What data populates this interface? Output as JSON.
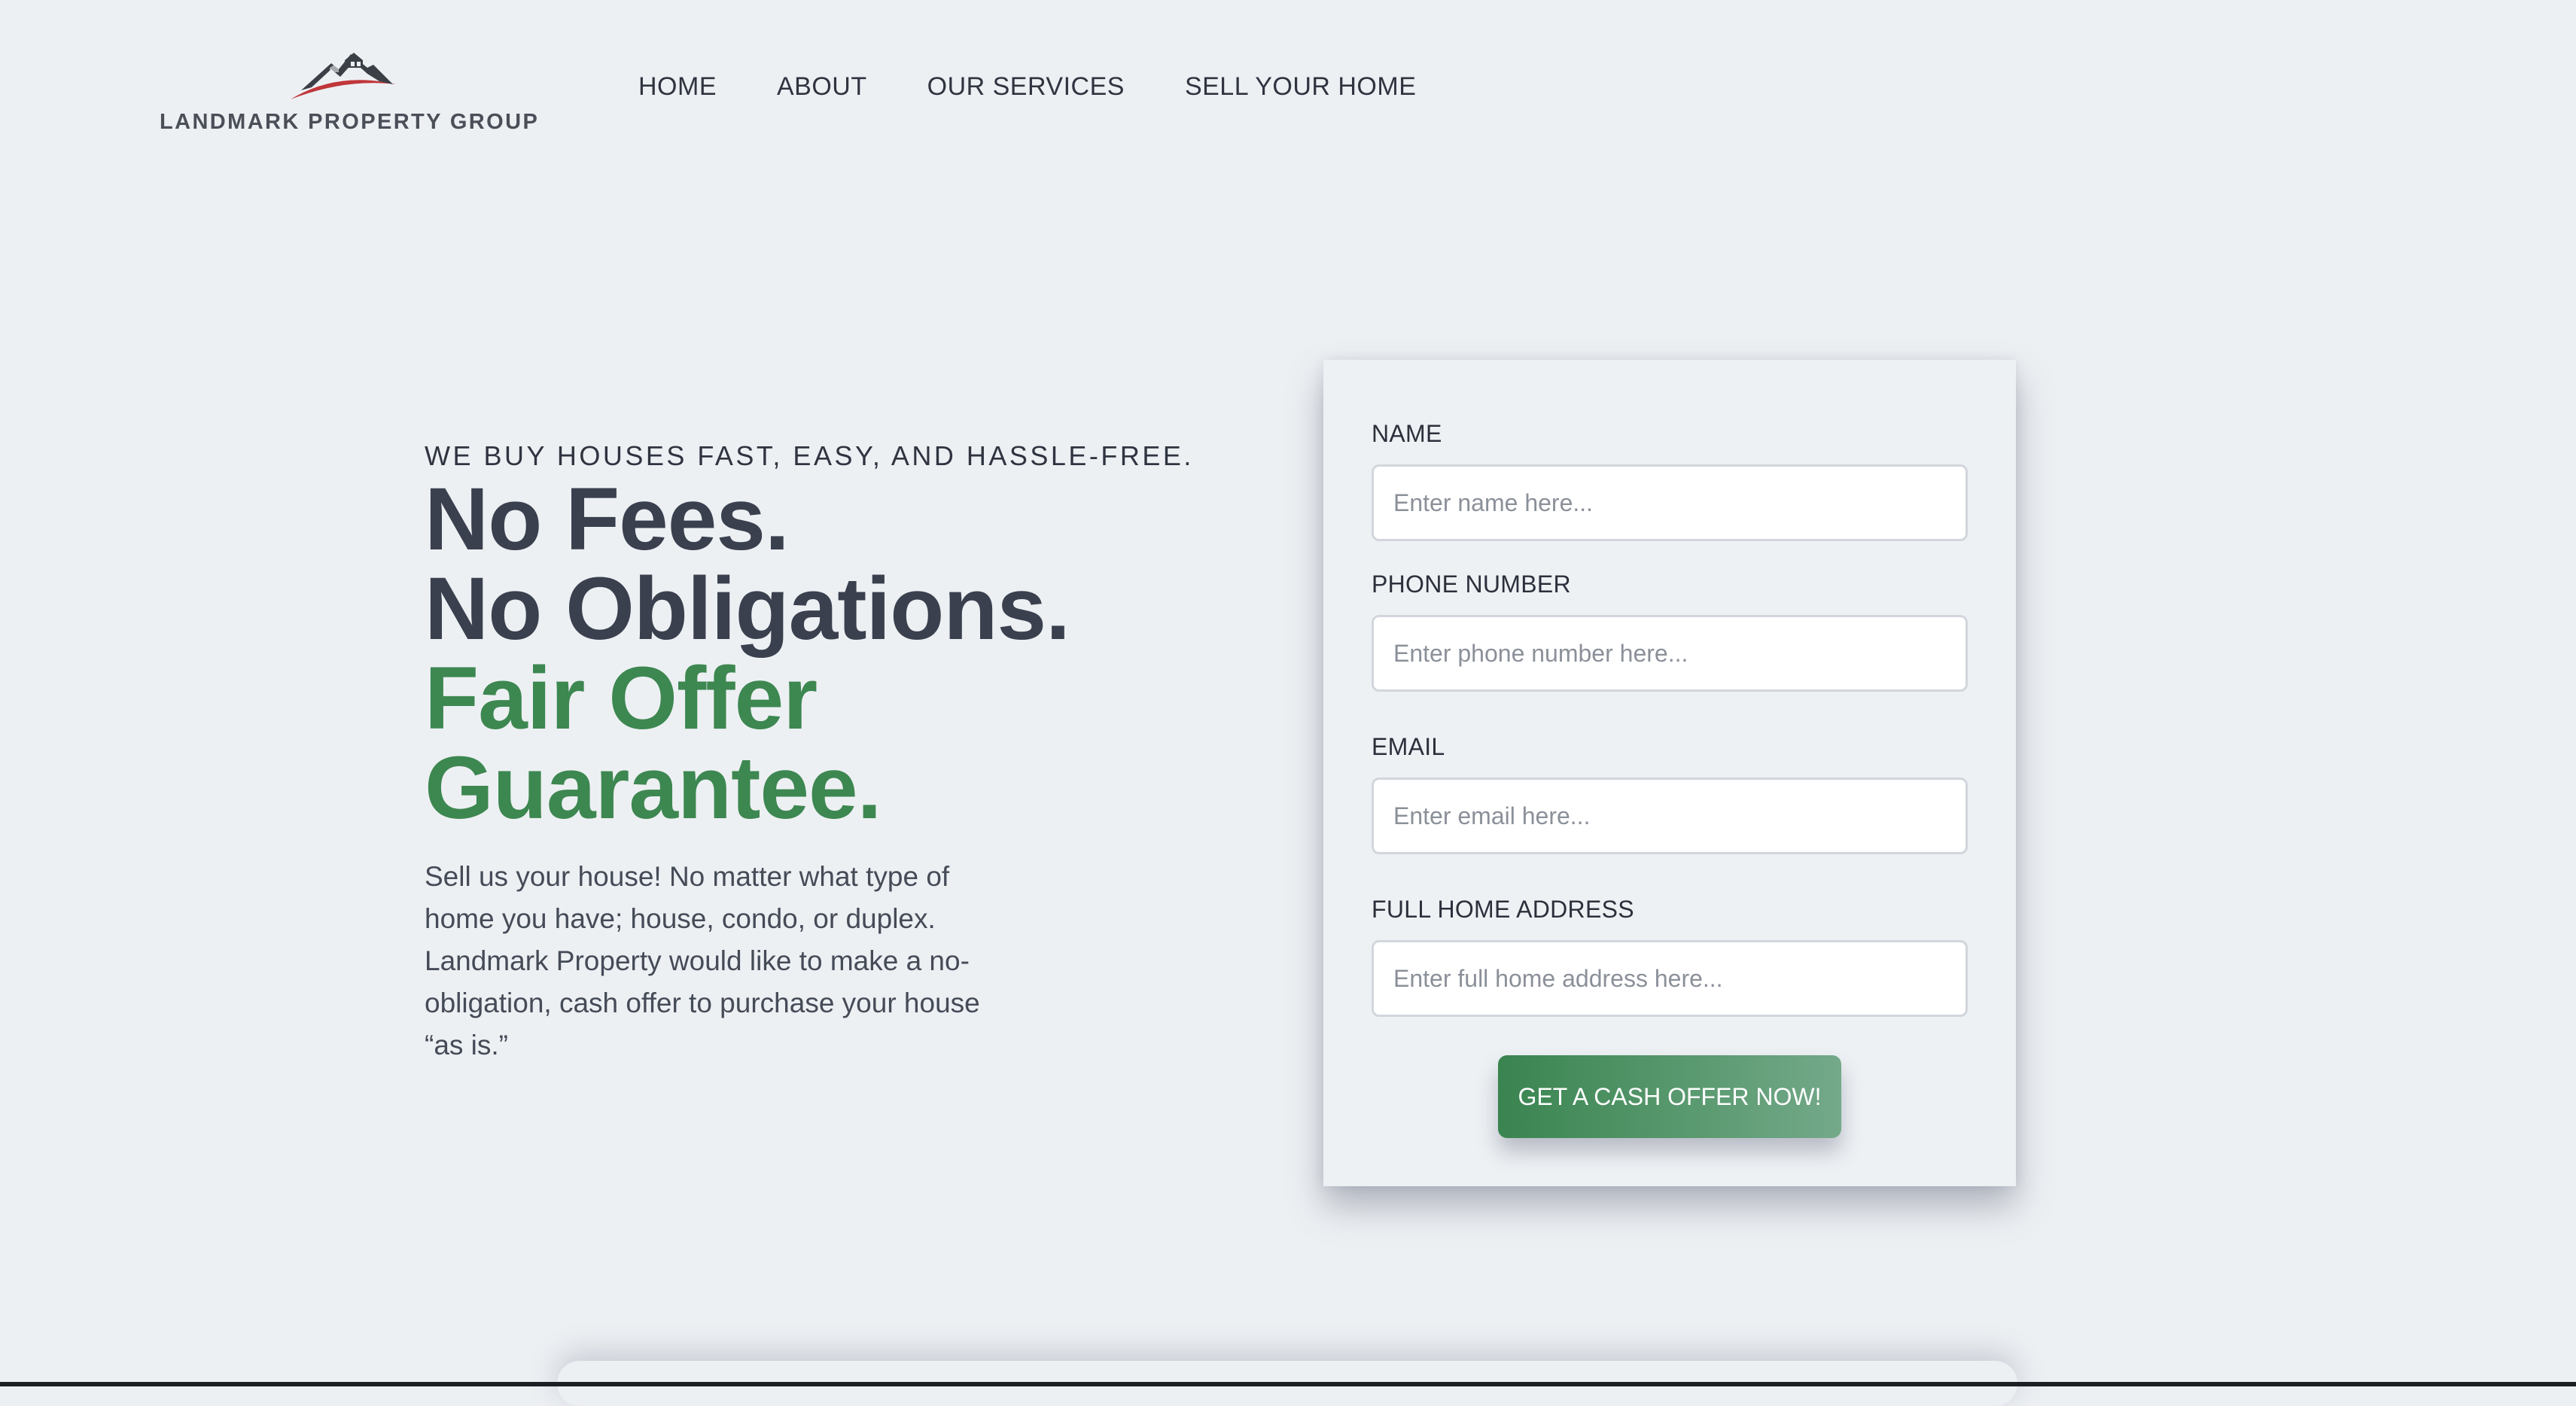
{
  "header": {
    "logo_text": "LANDMARK PROPERTY GROUP",
    "logo_icon": "house-roof-icon",
    "nav": [
      {
        "label": "HOME"
      },
      {
        "label": "ABOUT"
      },
      {
        "label": "OUR SERVICES"
      },
      {
        "label": "SELL YOUR HOME"
      }
    ]
  },
  "hero": {
    "eyebrow": "WE BUY HOUSES FAST, EASY, AND HASSLE-FREE.",
    "headline_line1": "No Fees.",
    "headline_line2": "No Obligations.",
    "headline_line3": "Fair Offer",
    "headline_line4": "Guarantee.",
    "intro": "Sell us your house! No matter what type of home you have; house, condo, or duplex. Landmark Property would like to make a no-obligation, cash offer to purchase your house “as is.”"
  },
  "form": {
    "name_label": "NAME",
    "name_placeholder": "Enter name here...",
    "phone_label": "PHONE NUMBER",
    "phone_placeholder": "Enter phone number here...",
    "email_label": "EMAIL",
    "email_placeholder": "Enter email here...",
    "address_label": "FULL HOME ADDRESS",
    "address_placeholder": "Enter full home address here...",
    "submit_label": "GET A CASH OFFER NOW!"
  },
  "colors": {
    "background": "#edf0f3",
    "heading_dark": "#3a404e",
    "accent_green": "#3d8751",
    "logo_red": "#c0363a"
  }
}
